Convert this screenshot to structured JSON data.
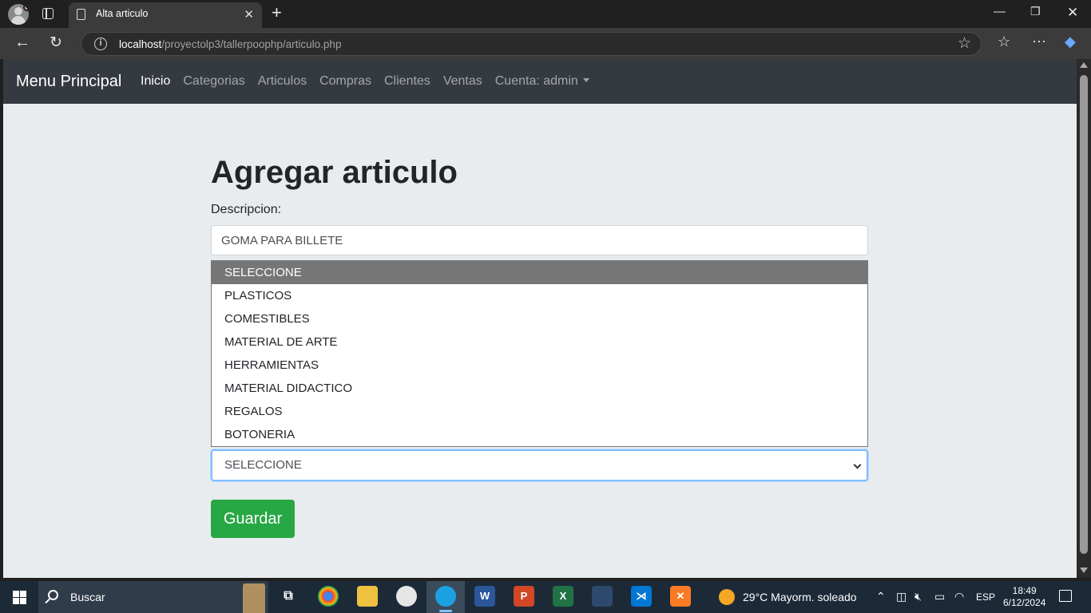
{
  "browser": {
    "tab_title": "Alta articulo",
    "url_host": "localhost",
    "url_path": "/proyectolp3/tallerpoophp/articulo.php"
  },
  "site_nav": {
    "brand": "Menu Principal",
    "links": [
      "Inicio",
      "Categorias",
      "Articulos",
      "Compras",
      "Clientes",
      "Ventas",
      "Cuenta: admin"
    ]
  },
  "form": {
    "title": "Agregar articulo",
    "description_label": "Descripcion:",
    "description_value": "GOMA PARA BILLETE",
    "category_selected": "SELECCIONE",
    "category_options": [
      "SELECCIONE",
      "PLASTICOS",
      "COMESTIBLES",
      "MATERIAL DE ARTE",
      "HERRAMIENTAS",
      "MATERIAL DIDACTICO",
      "REGALOS",
      "BOTONERIA"
    ],
    "save_label": "Guardar"
  },
  "taskbar": {
    "search_label": "Buscar",
    "weather": "29°C  Mayorm. soleado",
    "language": "ESP",
    "time": "18:49",
    "date": "6/12/2024"
  },
  "colors": {
    "navbar": "#343a40",
    "save_button": "#28a745",
    "focus_border": "#80bdff",
    "page_bg": "#e9ecef"
  }
}
